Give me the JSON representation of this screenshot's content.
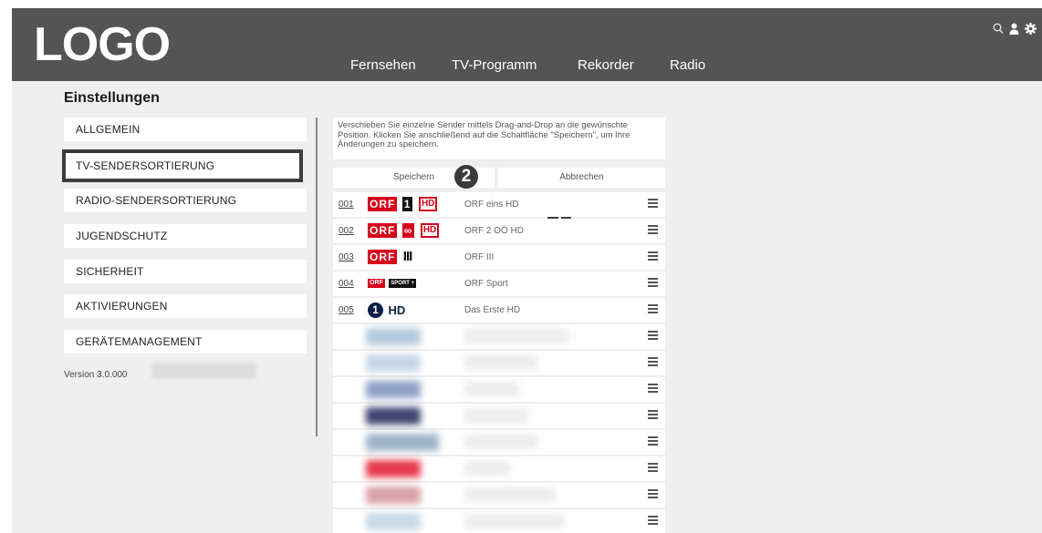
{
  "header": {
    "logo": "LOGO",
    "nav": [
      "Fernsehen",
      "TV-Programm",
      "Rekorder",
      "Radio"
    ],
    "icons": [
      "search-icon",
      "user-icon",
      "gear-icon"
    ]
  },
  "page_title": "Einstellungen",
  "sidebar": {
    "items": [
      {
        "label": "ALLGEMEIN"
      },
      {
        "label": "TV-SENDERSORTIERUNG",
        "active": true
      },
      {
        "label": "RADIO-SENDERSORTIERUNG"
      },
      {
        "label": "JUGENDSCHUTZ"
      },
      {
        "label": "SICHERHEIT"
      },
      {
        "label": "AKTIVIERUNGEN"
      },
      {
        "label": "GERÄTEMANAGEMENT"
      }
    ],
    "version": "Version 3.0.000"
  },
  "main": {
    "info": "Verschieben Sie einzelne Sender mittels Drag-and-Drop an die gewünschte Position. Klicken Sie anschließend auf die Schaltfläche \"Speichern\", um Ihre Änderungen zu speichern.",
    "save_label": "Speichern",
    "cancel_label": "Abbrechen",
    "marker_1": "1",
    "marker_2": "2",
    "channels": [
      {
        "number": "001",
        "name": "ORF eins HD",
        "logo_text": "ORF",
        "logo_badge": "1",
        "hd": "HD"
      },
      {
        "number": "002",
        "name": "ORF 2 OÖ HD",
        "logo_text": "ORF",
        "logo_badge": "∞",
        "hd": "HD"
      },
      {
        "number": "003",
        "name": "ORF III",
        "logo_text": "ORF",
        "logo_badge": "III"
      },
      {
        "number": "004",
        "name": "ORF Sport",
        "logo_text": "ORF",
        "logo_badge": "SPORT +"
      },
      {
        "number": "005",
        "name": "Das Erste HD",
        "logo_text": "1",
        "hd": "HD"
      }
    ],
    "accent_color": "#d6001c"
  }
}
